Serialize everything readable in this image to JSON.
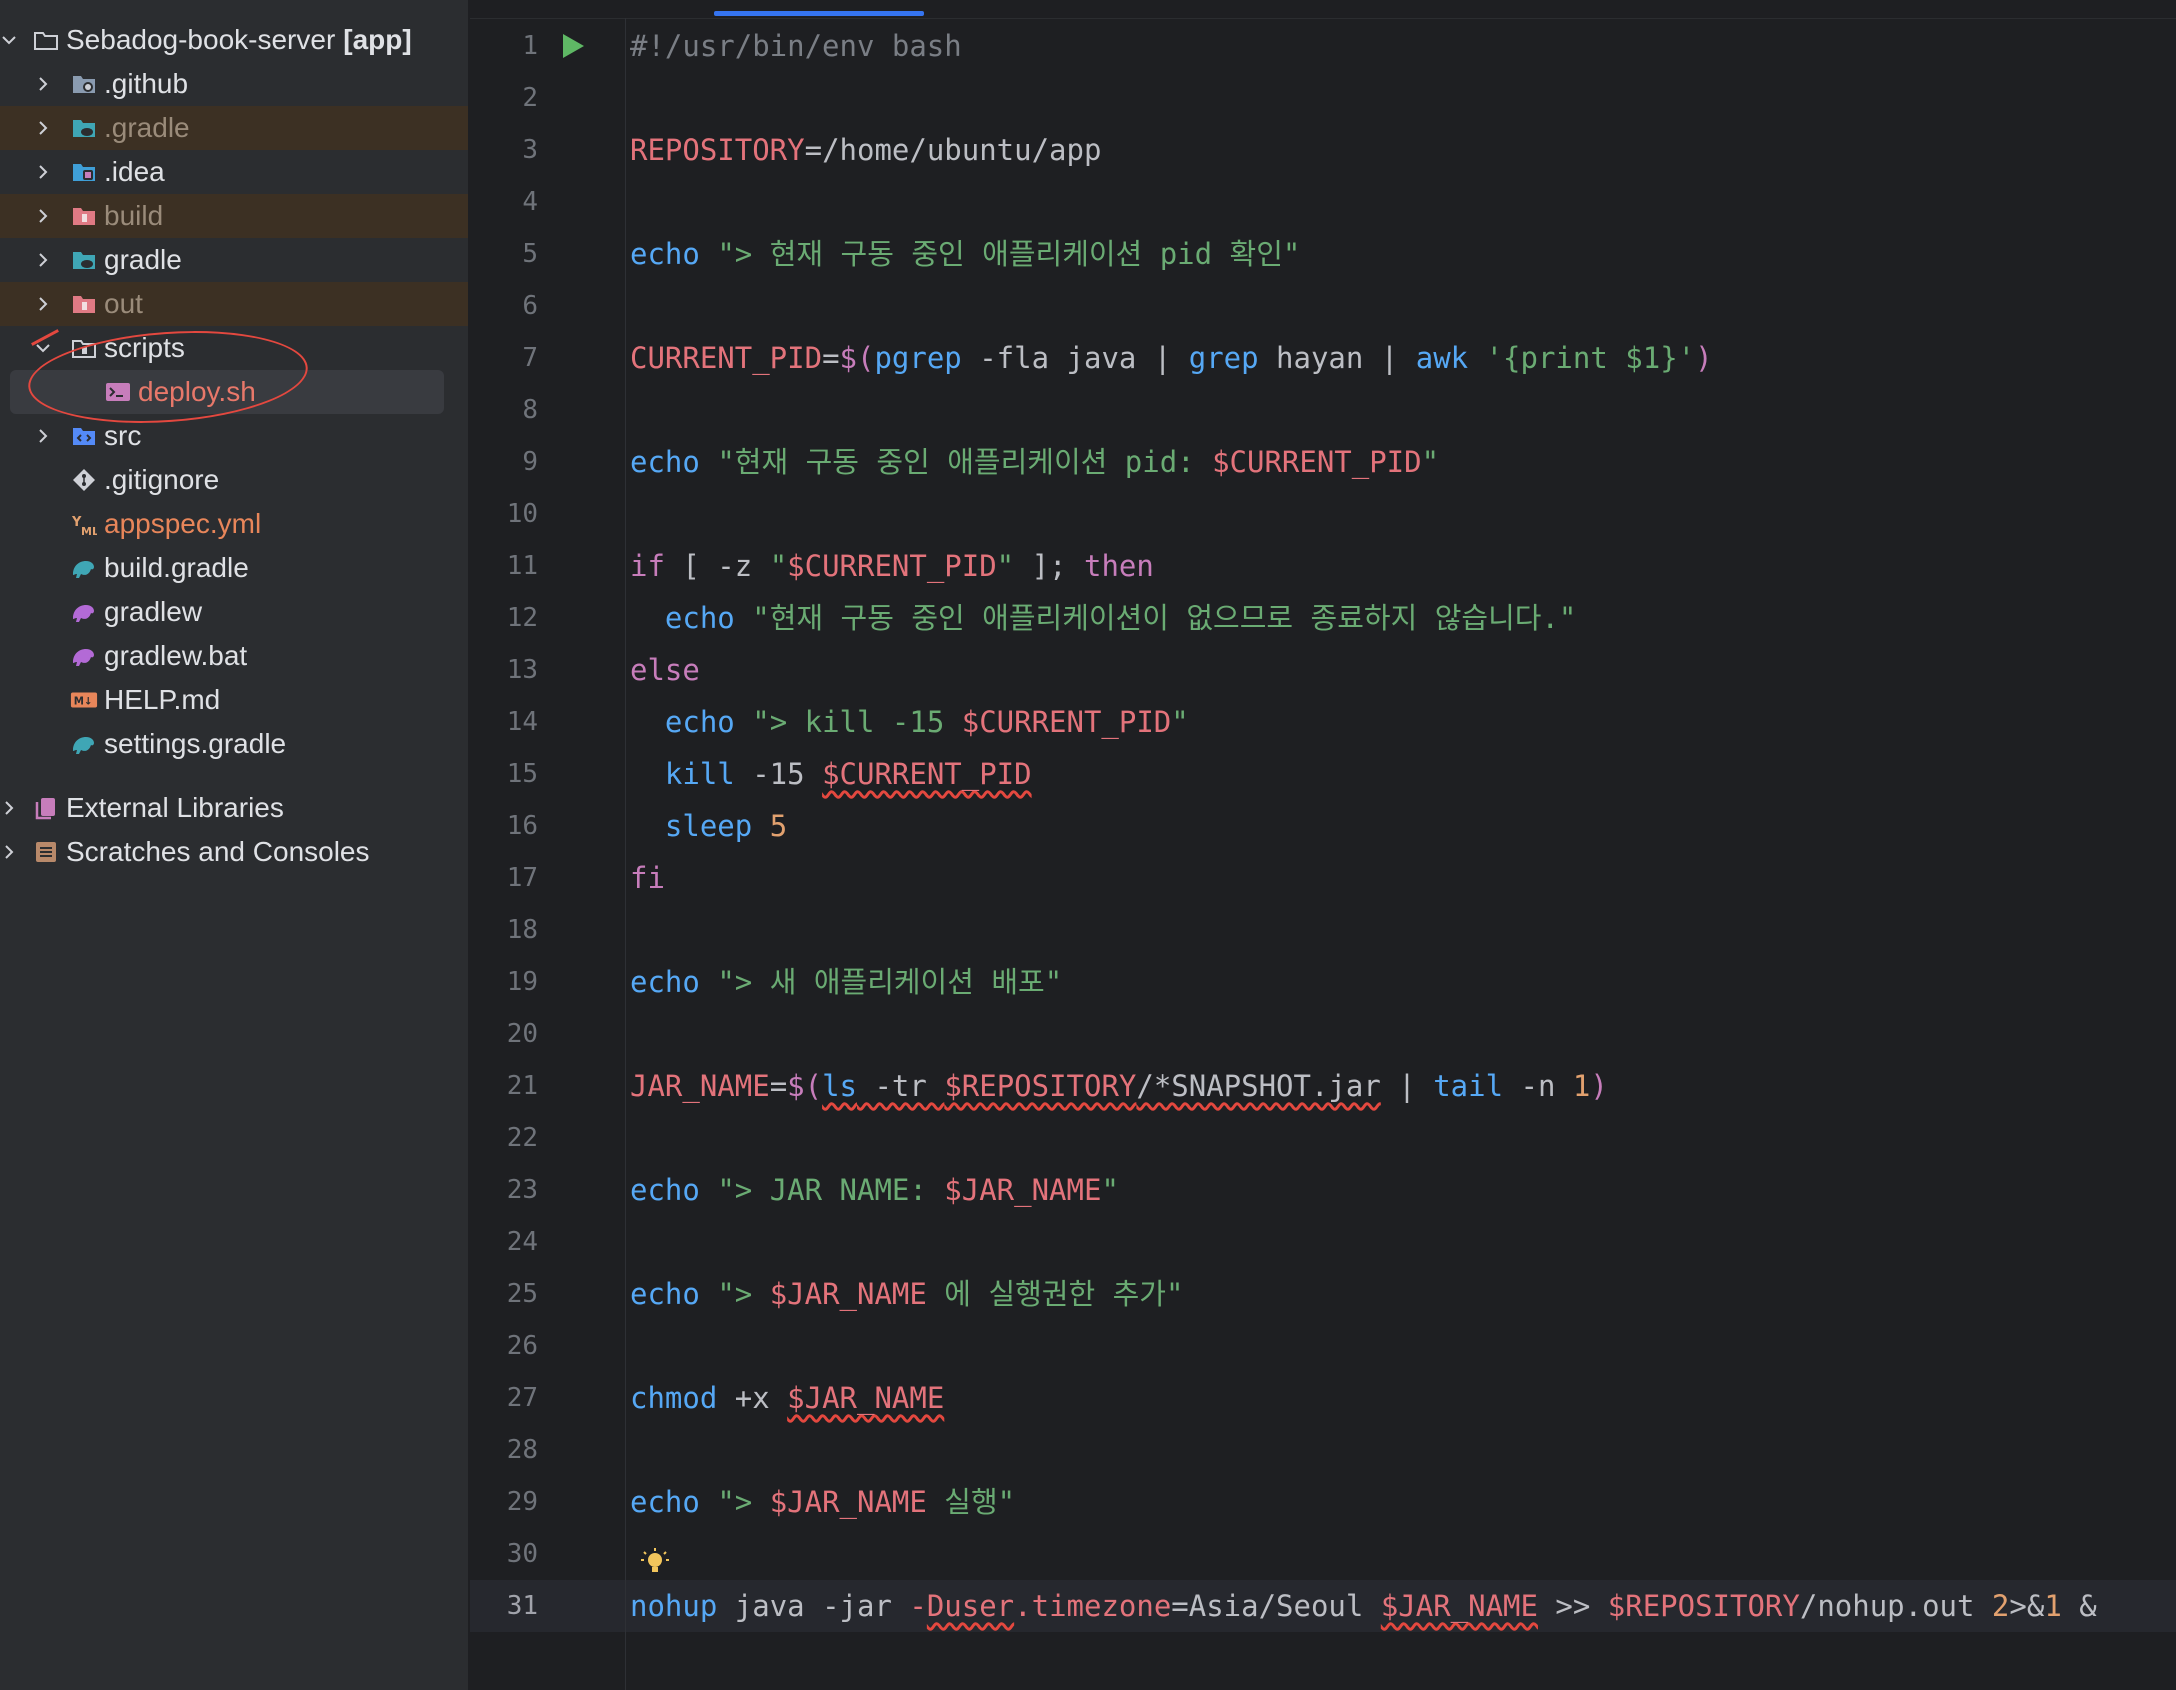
{
  "project_tree": {
    "root": {
      "name": "Sebadog-book-server",
      "module": "[app]"
    },
    "items": [
      {
        "label": ".github",
        "kind": "folder",
        "icon": "github-folder-icon",
        "expandable": true
      },
      {
        "label": ".gradle",
        "kind": "folder",
        "icon": "gradle-folder-icon",
        "expandable": true,
        "excluded": true
      },
      {
        "label": ".idea",
        "kind": "folder",
        "icon": "idea-folder-icon",
        "expandable": true
      },
      {
        "label": "build",
        "kind": "folder",
        "icon": "excluded-folder-icon",
        "expandable": true,
        "excluded": true
      },
      {
        "label": "gradle",
        "kind": "folder",
        "icon": "gradle-folder-icon",
        "expandable": true
      },
      {
        "label": "out",
        "kind": "folder",
        "icon": "excluded-folder-icon",
        "expandable": true,
        "excluded": true
      },
      {
        "label": "scripts",
        "kind": "folder",
        "icon": "folder-icon",
        "expanded": true
      },
      {
        "label": "deploy.sh",
        "kind": "file",
        "icon": "shell-script-icon",
        "selected": true
      },
      {
        "label": "src",
        "kind": "folder",
        "icon": "source-folder-icon",
        "expandable": true
      },
      {
        "label": ".gitignore",
        "kind": "file",
        "icon": "git-icon"
      },
      {
        "label": "appspec.yml",
        "kind": "file",
        "icon": "yaml-icon"
      },
      {
        "label": "build.gradle",
        "kind": "file",
        "icon": "gradle-icon"
      },
      {
        "label": "gradlew",
        "kind": "file",
        "icon": "gradle-wrapper-icon"
      },
      {
        "label": "gradlew.bat",
        "kind": "file",
        "icon": "gradle-wrapper-icon"
      },
      {
        "label": "HELP.md",
        "kind": "file",
        "icon": "markdown-icon"
      },
      {
        "label": "settings.gradle",
        "kind": "file",
        "icon": "gradle-icon"
      }
    ],
    "external_libraries": "External Libraries",
    "scratches": "Scratches and Consoles"
  },
  "editor": {
    "file": "deploy.sh",
    "current_line": 31,
    "line_numbers": [
      "1",
      "2",
      "3",
      "4",
      "5",
      "6",
      "7",
      "8",
      "9",
      "10",
      "11",
      "12",
      "13",
      "14",
      "15",
      "16",
      "17",
      "18",
      "19",
      "20",
      "21",
      "22",
      "23",
      "24",
      "25",
      "26",
      "27",
      "28",
      "29",
      "30",
      "31"
    ],
    "lines": [
      [
        {
          "t": "#!/usr/bin/env bash",
          "c": "cmt"
        }
      ],
      [],
      [
        {
          "t": "REPOSITORY",
          "c": "var"
        },
        {
          "t": "=/home/ubuntu/app",
          "c": "plain"
        }
      ],
      [],
      [
        {
          "t": "echo",
          "c": "cmd"
        },
        {
          "t": " ",
          "c": "plain"
        },
        {
          "t": "\"> 현재 구동 중인 애플리케이션 pid 확인\"",
          "c": "str"
        }
      ],
      [],
      [
        {
          "t": "CURRENT_PID",
          "c": "var"
        },
        {
          "t": "=",
          "c": "plain"
        },
        {
          "t": "$(",
          "c": "kw"
        },
        {
          "t": "pgrep",
          "c": "cmd"
        },
        {
          "t": " -fla java | ",
          "c": "plain"
        },
        {
          "t": "grep",
          "c": "cmd"
        },
        {
          "t": " hayan | ",
          "c": "plain"
        },
        {
          "t": "awk",
          "c": "cmd"
        },
        {
          "t": " ",
          "c": "plain"
        },
        {
          "t": "'{print $1}'",
          "c": "str"
        },
        {
          "t": ")",
          "c": "kw"
        }
      ],
      [],
      [
        {
          "t": "echo",
          "c": "cmd"
        },
        {
          "t": " ",
          "c": "plain"
        },
        {
          "t": "\"현재 구동 중인 애플리케이션 pid: ",
          "c": "str"
        },
        {
          "t": "$CURRENT_PID",
          "c": "var"
        },
        {
          "t": "\"",
          "c": "str"
        }
      ],
      [],
      [
        {
          "t": "if",
          "c": "kw"
        },
        {
          "t": " [ -z ",
          "c": "plain"
        },
        {
          "t": "\"",
          "c": "str"
        },
        {
          "t": "$CURRENT_PID",
          "c": "var"
        },
        {
          "t": "\"",
          "c": "str"
        },
        {
          "t": " ]; ",
          "c": "plain"
        },
        {
          "t": "then",
          "c": "kw"
        }
      ],
      [
        {
          "t": "  ",
          "c": "plain"
        },
        {
          "t": "echo",
          "c": "cmd"
        },
        {
          "t": " ",
          "c": "plain"
        },
        {
          "t": "\"현재 구동 중인 애플리케이션이 없으므로 종료하지 않습니다.\"",
          "c": "str"
        }
      ],
      [
        {
          "t": "else",
          "c": "kw"
        }
      ],
      [
        {
          "t": "  ",
          "c": "plain"
        },
        {
          "t": "echo",
          "c": "cmd"
        },
        {
          "t": " ",
          "c": "plain"
        },
        {
          "t": "\"> kill -15 ",
          "c": "str"
        },
        {
          "t": "$CURRENT_PID",
          "c": "var"
        },
        {
          "t": "\"",
          "c": "str"
        }
      ],
      [
        {
          "t": "  ",
          "c": "plain"
        },
        {
          "t": "kill",
          "c": "cmd"
        },
        {
          "t": " -15 ",
          "c": "plain"
        },
        {
          "t": "$CURRENT_PID",
          "c": "var",
          "err": true
        }
      ],
      [
        {
          "t": "  ",
          "c": "plain"
        },
        {
          "t": "sleep",
          "c": "cmd"
        },
        {
          "t": " ",
          "c": "plain"
        },
        {
          "t": "5",
          "c": "num"
        }
      ],
      [
        {
          "t": "fi",
          "c": "kw"
        }
      ],
      [],
      [
        {
          "t": "echo",
          "c": "cmd"
        },
        {
          "t": " ",
          "c": "plain"
        },
        {
          "t": "\"> 새 애플리케이션 배포\"",
          "c": "str"
        }
      ],
      [],
      [
        {
          "t": "JAR_NAME",
          "c": "var"
        },
        {
          "t": "=",
          "c": "plain"
        },
        {
          "t": "$(",
          "c": "kw"
        },
        {
          "t": "ls",
          "c": "cmd",
          "err": true
        },
        {
          "t": " -tr ",
          "c": "plain",
          "err": true
        },
        {
          "t": "$REPOSITORY",
          "c": "var",
          "err": true
        },
        {
          "t": "/*SNAPSHOT.jar",
          "c": "plain",
          "err": true
        },
        {
          "t": " | ",
          "c": "plain"
        },
        {
          "t": "tail",
          "c": "cmd"
        },
        {
          "t": " -n ",
          "c": "plain"
        },
        {
          "t": "1",
          "c": "num"
        },
        {
          "t": ")",
          "c": "kw"
        }
      ],
      [],
      [
        {
          "t": "echo",
          "c": "cmd"
        },
        {
          "t": " ",
          "c": "plain"
        },
        {
          "t": "\"> JAR NAME: ",
          "c": "str"
        },
        {
          "t": "$JAR_NAME",
          "c": "var"
        },
        {
          "t": "\"",
          "c": "str"
        }
      ],
      [],
      [
        {
          "t": "echo",
          "c": "cmd"
        },
        {
          "t": " ",
          "c": "plain"
        },
        {
          "t": "\"> ",
          "c": "str"
        },
        {
          "t": "$JAR_NAME",
          "c": "var"
        },
        {
          "t": " 에 실행권한 추가\"",
          "c": "str"
        }
      ],
      [],
      [
        {
          "t": "chmod",
          "c": "cmd"
        },
        {
          "t": " +x ",
          "c": "plain"
        },
        {
          "t": "$JAR_NAME",
          "c": "var",
          "err": true
        }
      ],
      [],
      [
        {
          "t": "echo",
          "c": "cmd"
        },
        {
          "t": " ",
          "c": "plain"
        },
        {
          "t": "\"> ",
          "c": "str"
        },
        {
          "t": "$JAR_NAME",
          "c": "var"
        },
        {
          "t": " 실행\"",
          "c": "str"
        }
      ],
      [],
      [
        {
          "t": "nohup",
          "c": "cmd"
        },
        {
          "t": " java -jar ",
          "c": "plain"
        },
        {
          "t": "-",
          "c": "var"
        },
        {
          "t": "Duser",
          "c": "var",
          "err": true
        },
        {
          "t": ".timezone",
          "c": "var"
        },
        {
          "t": "=Asia/Seoul ",
          "c": "plain"
        },
        {
          "t": "$JAR_NAME",
          "c": "var",
          "err": true
        },
        {
          "t": " >> ",
          "c": "plain"
        },
        {
          "t": "$REPOSITORY",
          "c": "var"
        },
        {
          "t": "/nohup.out ",
          "c": "plain"
        },
        {
          "t": "2",
          "c": "num"
        },
        {
          "t": ">&",
          "c": "plain"
        },
        {
          "t": "1",
          "c": "num"
        },
        {
          "t": " &",
          "c": "plain"
        }
      ]
    ]
  },
  "icons": {
    "run": "run-icon",
    "intention": "lightbulb-icon"
  },
  "colors": {
    "accent": "#3574f0",
    "annotation": "#e4483f",
    "run_green": "#5fb865",
    "bulb_yellow": "#f2c55c"
  }
}
